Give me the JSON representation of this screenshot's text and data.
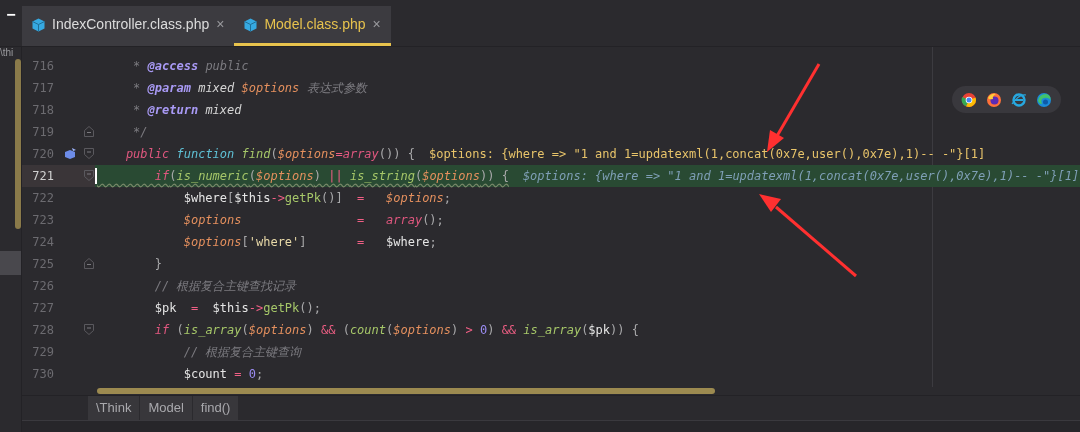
{
  "project_panel": {
    "collapse_button": "−",
    "path_fragment": "\\thi"
  },
  "tabs": [
    {
      "label": "IndexController.class.php",
      "close": "×",
      "selected": false
    },
    {
      "label": "Model.class.php",
      "close": "×",
      "selected": true
    }
  ],
  "lines": [
    {
      "number": "716",
      "fold_open": false,
      "fold_close": false,
      "marker": false,
      "current": false,
      "warning": false,
      "tokens": [
        {
          "kind": "cmt",
          "text": "     * "
        },
        {
          "kind": "tag",
          "text": "@access"
        },
        {
          "kind": "cmt",
          "text": " public"
        }
      ]
    },
    {
      "number": "717",
      "fold_open": false,
      "fold_close": false,
      "marker": false,
      "current": false,
      "warning": false,
      "tokens": [
        {
          "kind": "cmt",
          "text": "     * "
        },
        {
          "kind": "tag",
          "text": "@param"
        },
        {
          "kind": "doc",
          "text": " mixed "
        },
        {
          "kind": "var",
          "text": "$options"
        },
        {
          "kind": "cmt",
          "text": " 表达式参数"
        }
      ]
    },
    {
      "number": "718",
      "fold_open": false,
      "fold_close": false,
      "marker": false,
      "current": false,
      "warning": false,
      "tokens": [
        {
          "kind": "cmt",
          "text": "     * "
        },
        {
          "kind": "tag",
          "text": "@return"
        },
        {
          "kind": "doc",
          "text": " mixed"
        }
      ]
    },
    {
      "number": "719",
      "fold_open": false,
      "fold_close": true,
      "marker": false,
      "current": false,
      "warning": false,
      "tokens": [
        {
          "kind": "cmt",
          "text": "     */"
        }
      ]
    },
    {
      "number": "720",
      "fold_open": true,
      "fold_close": false,
      "marker": true,
      "current": false,
      "warning": false,
      "tokens": [
        {
          "kind": "kw",
          "text": "    public "
        },
        {
          "kind": "kw2",
          "text": "function "
        },
        {
          "kind": "fn",
          "text": "find"
        },
        {
          "kind": "p",
          "text": "("
        },
        {
          "kind": "var",
          "text": "$options"
        },
        {
          "kind": "op",
          "text": "="
        },
        {
          "kind": "kw",
          "text": "array"
        },
        {
          "kind": "p",
          "text": "()) {"
        }
      ],
      "hint": {
        "kind": "value",
        "text": "$options: {where => \"1 and 1=updatexml(1,concat(0x7e,user(),0x7e),1)-- -\"}[1]"
      }
    },
    {
      "number": "721",
      "fold_open": true,
      "fold_close": false,
      "marker": false,
      "current": true,
      "warning": true,
      "tokens": [
        {
          "kind": "kw",
          "text": "        if"
        },
        {
          "kind": "p",
          "text": "("
        },
        {
          "kind": "fn",
          "text": "is_numeric"
        },
        {
          "kind": "p",
          "text": "("
        },
        {
          "kind": "var",
          "text": "$options"
        },
        {
          "kind": "p",
          "text": ") "
        },
        {
          "kind": "op",
          "text": "|| "
        },
        {
          "kind": "fn",
          "text": "is_string"
        },
        {
          "kind": "p",
          "text": "("
        },
        {
          "kind": "var",
          "text": "$options"
        },
        {
          "kind": "p",
          "text": ")) {"
        }
      ],
      "hint": {
        "kind": "inline",
        "text": "$options: {where => \"1 and 1=updatexml(1,concat(0x7e,user(),0x7e),1)-- -\"}[1]"
      }
    },
    {
      "number": "722",
      "fold_open": false,
      "fold_close": false,
      "marker": false,
      "current": false,
      "warning": false,
      "tokens": [
        {
          "kind": "id",
          "text": "            $where"
        },
        {
          "kind": "p",
          "text": "["
        },
        {
          "kind": "id",
          "text": "$this"
        },
        {
          "kind": "op",
          "text": "->"
        },
        {
          "kind": "fn2",
          "text": "getPk"
        },
        {
          "kind": "p",
          "text": "()]  "
        },
        {
          "kind": "op",
          "text": "=   "
        },
        {
          "kind": "var",
          "text": "$options"
        },
        {
          "kind": "p",
          "text": ";"
        }
      ]
    },
    {
      "number": "723",
      "fold_open": false,
      "fold_close": false,
      "marker": false,
      "current": false,
      "warning": false,
      "tokens": [
        {
          "kind": "var",
          "text": "            $options                "
        },
        {
          "kind": "op",
          "text": "=   "
        },
        {
          "kind": "kw",
          "text": "array"
        },
        {
          "kind": "p",
          "text": "();"
        }
      ]
    },
    {
      "number": "724",
      "fold_open": false,
      "fold_close": false,
      "marker": false,
      "current": false,
      "warning": false,
      "tokens": [
        {
          "kind": "var",
          "text": "            $options"
        },
        {
          "kind": "p",
          "text": "["
        },
        {
          "kind": "str",
          "text": "'where'"
        },
        {
          "kind": "p",
          "text": "]       "
        },
        {
          "kind": "op",
          "text": "=   "
        },
        {
          "kind": "id",
          "text": "$where"
        },
        {
          "kind": "p",
          "text": ";"
        }
      ]
    },
    {
      "number": "725",
      "fold_open": false,
      "fold_close": true,
      "marker": false,
      "current": false,
      "warning": false,
      "tokens": [
        {
          "kind": "p",
          "text": "        }"
        }
      ]
    },
    {
      "number": "726",
      "fold_open": false,
      "fold_close": false,
      "marker": false,
      "current": false,
      "warning": false,
      "tokens": [
        {
          "kind": "cmt",
          "text": "        // 根据复合主键查找记录"
        }
      ]
    },
    {
      "number": "727",
      "fold_open": false,
      "fold_close": false,
      "marker": false,
      "current": false,
      "warning": false,
      "tokens": [
        {
          "kind": "id",
          "text": "        $pk  "
        },
        {
          "kind": "op",
          "text": "=  "
        },
        {
          "kind": "id",
          "text": "$this"
        },
        {
          "kind": "op",
          "text": "->"
        },
        {
          "kind": "fn2",
          "text": "getPk"
        },
        {
          "kind": "p",
          "text": "();"
        }
      ]
    },
    {
      "number": "728",
      "fold_open": true,
      "fold_close": false,
      "marker": false,
      "current": false,
      "warning": false,
      "tokens": [
        {
          "kind": "kw",
          "text": "        if"
        },
        {
          "kind": "p",
          "text": " ("
        },
        {
          "kind": "fn",
          "text": "is_array"
        },
        {
          "kind": "p",
          "text": "("
        },
        {
          "kind": "var",
          "text": "$options"
        },
        {
          "kind": "p",
          "text": ") "
        },
        {
          "kind": "op",
          "text": "&&"
        },
        {
          "kind": "p",
          "text": " ("
        },
        {
          "kind": "fn",
          "text": "count"
        },
        {
          "kind": "p",
          "text": "("
        },
        {
          "kind": "var",
          "text": "$options"
        },
        {
          "kind": "p",
          "text": ") "
        },
        {
          "kind": "op",
          "text": "> "
        },
        {
          "kind": "num",
          "text": "0"
        },
        {
          "kind": "p",
          "text": ") "
        },
        {
          "kind": "op",
          "text": "&& "
        },
        {
          "kind": "fn",
          "text": "is_array"
        },
        {
          "kind": "p",
          "text": "("
        },
        {
          "kind": "id",
          "text": "$pk"
        },
        {
          "kind": "p",
          "text": ")) {"
        }
      ]
    },
    {
      "number": "729",
      "fold_open": false,
      "fold_close": false,
      "marker": false,
      "current": false,
      "warning": false,
      "tokens": [
        {
          "kind": "cmt",
          "text": "            // 根据复合主键查询"
        }
      ]
    },
    {
      "number": "730",
      "fold_open": false,
      "fold_close": false,
      "marker": false,
      "current": false,
      "warning": false,
      "tokens": [
        {
          "kind": "id",
          "text": "            $count "
        },
        {
          "kind": "op",
          "text": "= "
        },
        {
          "kind": "num",
          "text": "0"
        },
        {
          "kind": "p",
          "text": ";"
        }
      ]
    }
  ],
  "breadcrumbs": [
    "\\Think",
    "Model",
    "find()"
  ]
}
